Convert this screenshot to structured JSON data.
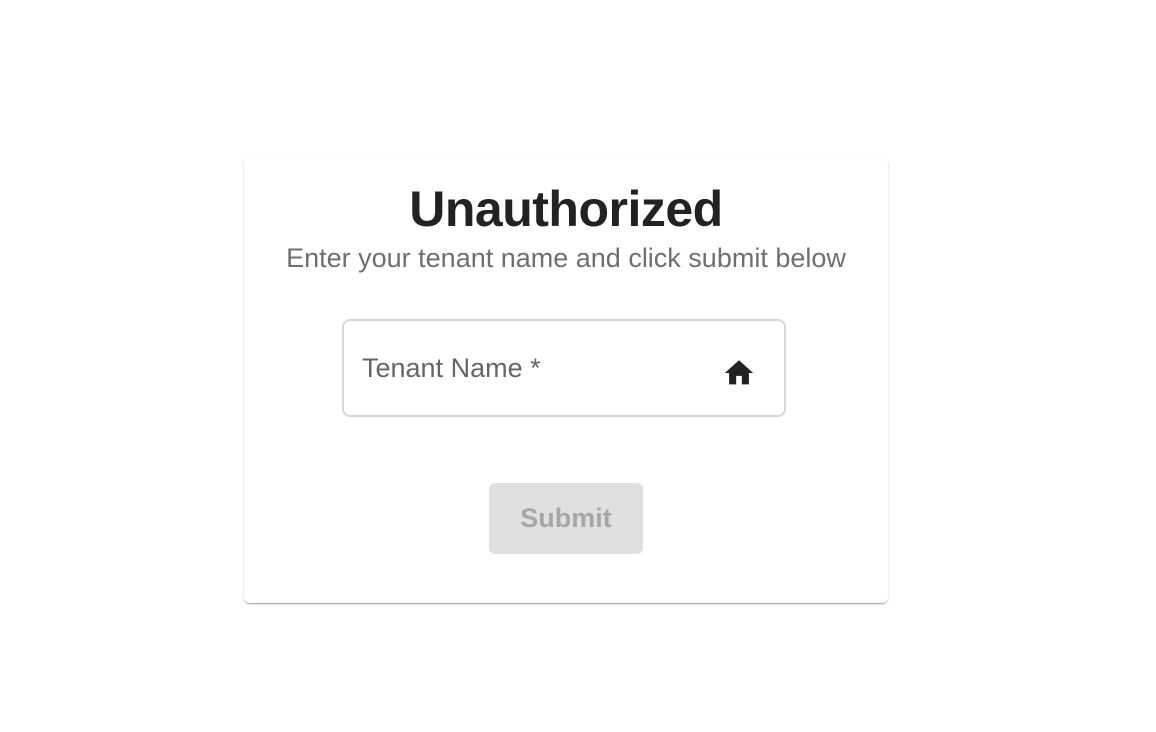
{
  "card": {
    "title": "Unauthorized",
    "subtitle": "Enter your tenant name and click submit below"
  },
  "tenant_field": {
    "placeholder": "Tenant Name *",
    "value": "",
    "icon": "home-icon"
  },
  "submit": {
    "label": "Submit",
    "disabled": true
  },
  "colors": {
    "title": "#222222",
    "subtitle": "#6f6f6f",
    "field_border": "#d6d6d6",
    "button_bg_disabled": "#e0e0e0",
    "button_text_disabled": "#a6a6a6"
  }
}
